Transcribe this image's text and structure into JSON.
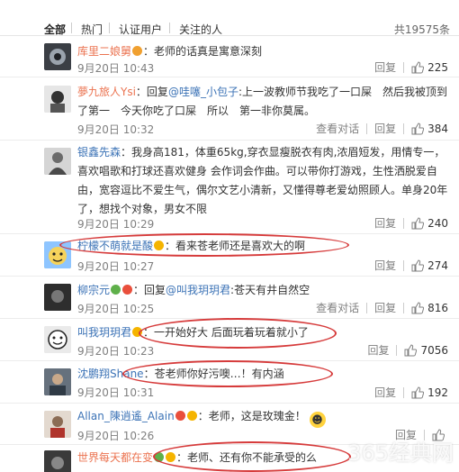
{
  "tabs": [
    "全部",
    "热门",
    "认证用户",
    "关注的人"
  ],
  "total": "共19575条",
  "actions": {
    "reply": "回复",
    "view_chat": "查看对话"
  },
  "comments": [
    {
      "user": "库里二娘舅",
      "text": "：老师的话真是寓意深刻",
      "time": "9月20日 10:43",
      "likes": "225"
    },
    {
      "user": "夢九旅人Ysi",
      "text_pre": "：回复",
      "mention": "@哇噻_小包子",
      "text": ":上一波教师节我吃了一口屎　然后我被顶到了第一　今天你吃了口屎　所以　第一非你莫属。",
      "time": "9月20日 10:32",
      "likes": "384"
    },
    {
      "user": "银鑫先森",
      "text": "：我身高181，体重65kg,穿衣显瘦脱衣有肉,浓眉短发，用情专一，喜欢唱歌和打球还喜欢健身 会作词会作曲。可以带你打游戏，生性洒脱爱自由，宽容逗比不爱生气，偶尔文艺小清新，又懂得尊老爱幼照顾人。单身20年了，想找个对象，男女不限",
      "time": "9月20日 10:29",
      "likes": "240"
    },
    {
      "user": "柠檬不萌就是酸",
      "text": "：看来苍老师还是喜欢大的啊",
      "time": "9月20日 10:27",
      "likes": "274"
    },
    {
      "user": "柳宗元",
      "text_pre": "：回复",
      "mention": "@叫我玥玥君",
      "text": ":苍天有井自然空",
      "time": "9月20日 10:25",
      "likes": "816"
    },
    {
      "user": "叫我玥玥君",
      "text": "：一开始好大 后面玩着玩着就小了",
      "time": "9月20日 10:23",
      "likes": "7056"
    },
    {
      "user": "沈鹏翔Shane",
      "text": "：苍老师你好污噢…！有内涵",
      "time": "9月20日 10:31",
      "likes": "192"
    },
    {
      "user": "Allan_陳逍遙_Alain",
      "text": "：老师，这是玫瑰金！",
      "time": "9月20日 10:26",
      "likes": ""
    },
    {
      "user": "世界每天都在变",
      "text": "：老师、还有你不能承受的么",
      "time": "",
      "likes": ""
    }
  ],
  "watermark": "365经典网",
  "colors": {
    "username": "#eb7350",
    "link": "#3c73b6",
    "meta": "#808080",
    "highlight": "#d63b3b"
  }
}
